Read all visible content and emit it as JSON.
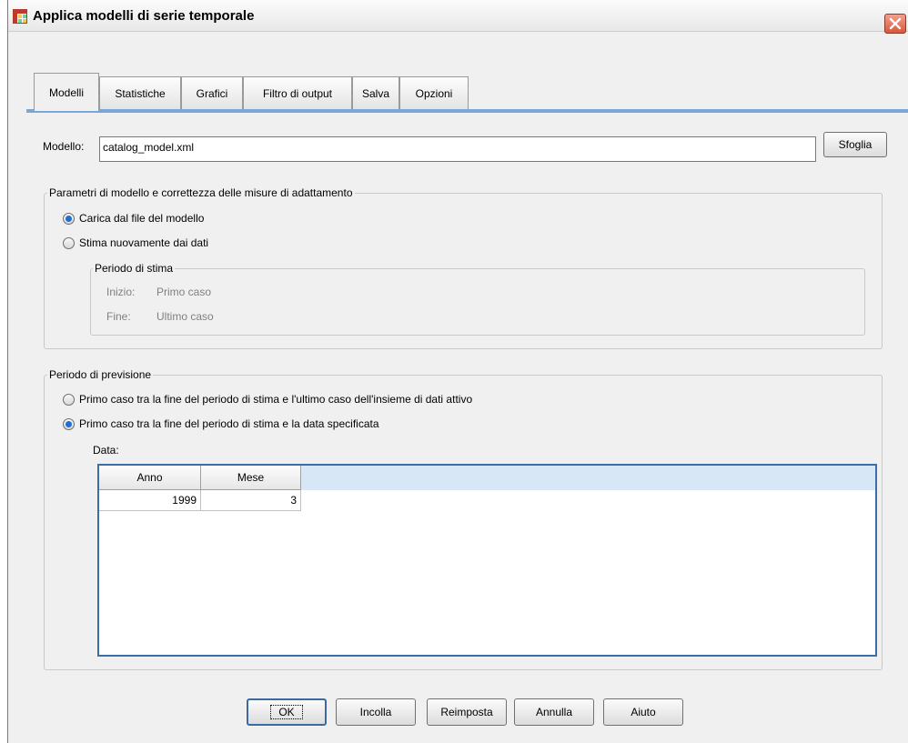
{
  "window": {
    "title": "Applica modelli di serie temporale"
  },
  "tabs": [
    {
      "label": "Modelli"
    },
    {
      "label": "Statistiche"
    },
    {
      "label": "Grafici"
    },
    {
      "label": "Filtro di output"
    },
    {
      "label": "Salva"
    },
    {
      "label": "Opzioni"
    }
  ],
  "model": {
    "label": "Modello:",
    "value": "catalog_model.xml",
    "browse_label": "Sfoglia"
  },
  "parameters_group": {
    "title": "Parametri di modello e correttezza delle misure di adattamento",
    "option_load": "Carica dal file del modello",
    "option_reestimate": "Stima nuovamente dai dati",
    "selected": "load",
    "estimation_period": {
      "title": "Periodo di stima",
      "start_label": "Inizio:",
      "start_value": "Primo caso",
      "end_label": "Fine:",
      "end_value": "Ultimo caso"
    }
  },
  "forecast_group": {
    "title": "Periodo di previsione",
    "option_active": "Primo caso tra la fine del periodo di stima e l'ultimo caso dell'insieme di dati attivo",
    "option_date": "Primo caso tra la fine del periodo di stima e la data specificata",
    "selected": "date",
    "date_label": "Data:",
    "columns": [
      "Anno",
      "Mese"
    ],
    "rows": [
      [
        "1999",
        "3"
      ]
    ]
  },
  "buttons": {
    "ok": "OK",
    "paste": "Incolla",
    "reset": "Reimposta",
    "cancel": "Annulla",
    "help": "Aiuto"
  },
  "colors": {
    "accent": "#3a6ea5",
    "tab_underline": "#7aa7d6",
    "radio_selected": "#1d6fd6",
    "close_button": "#d9583a"
  },
  "icons": {
    "app": "table-grid-icon",
    "close": "close-icon"
  }
}
